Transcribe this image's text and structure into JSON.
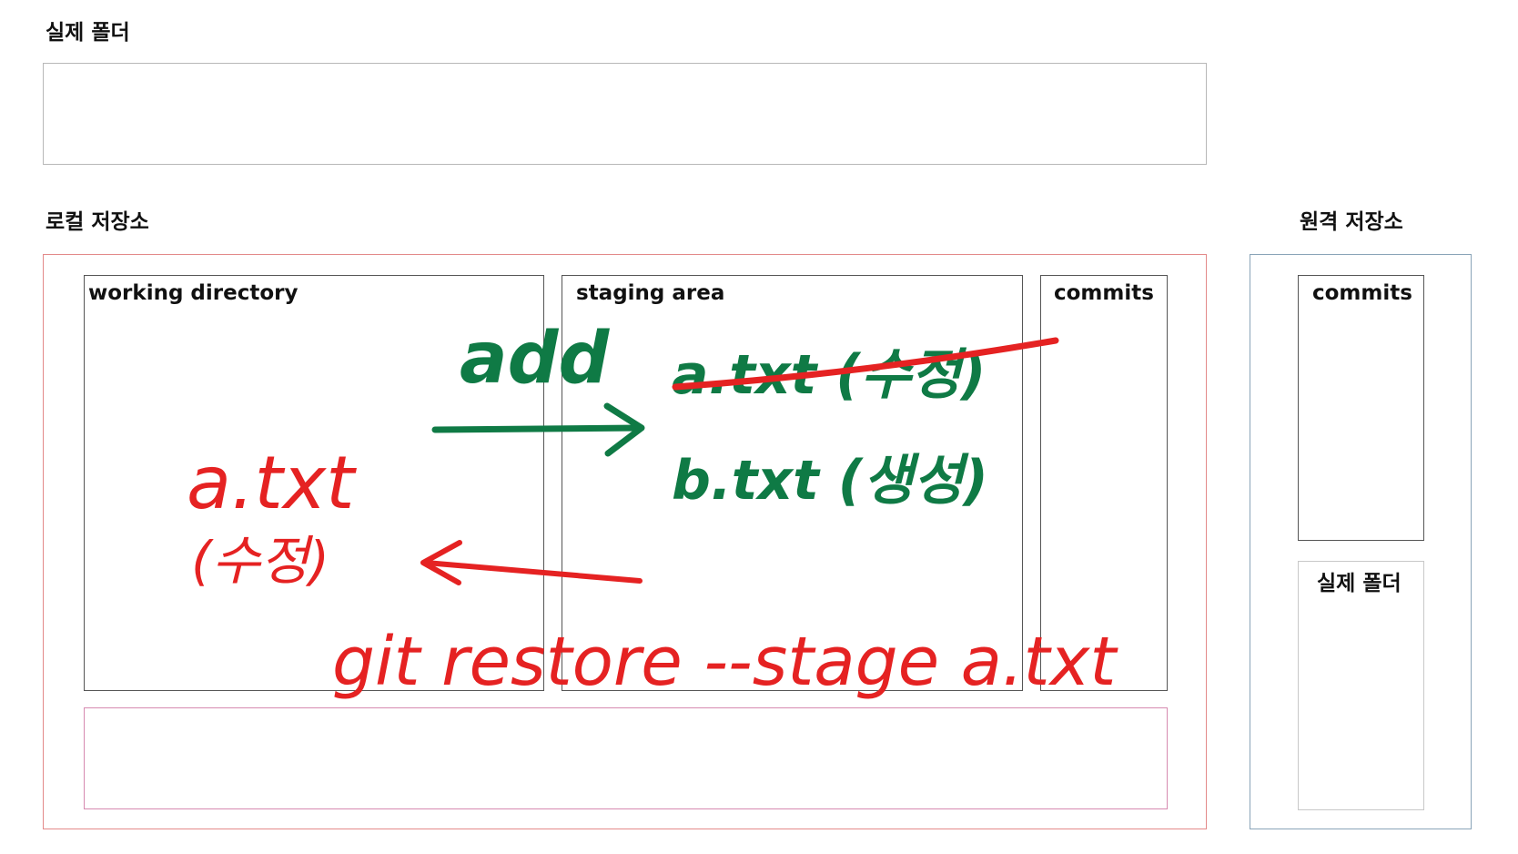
{
  "colors": {
    "top_box_border": "#b8b8b8",
    "local_border": "#e38a8a",
    "remote_border": "#8aa4b8",
    "panel_border": "#555555",
    "bottom_box_border": "#d68ab0",
    "remote_folder_border": "#c8c8c8",
    "ink_green": "#0f7a45",
    "ink_red": "#e52222"
  },
  "sections": {
    "top_folder_title": "실제 폴더",
    "local_repo_title": "로컬 저장소",
    "remote_repo_title": "원격 저장소"
  },
  "local": {
    "working_directory": "working directory",
    "staging_area": "staging area",
    "commits": "commits"
  },
  "remote": {
    "commits": "commits",
    "real_folder": "실제 폴더"
  },
  "annotations": {
    "add_label": "add",
    "staged_file_1": "a.txt (수정)",
    "staged_file_2": "b.txt (생성)",
    "working_file_name": "a.txt",
    "working_file_status": "(수정)",
    "restore_command": "git restore --stage a.txt"
  }
}
